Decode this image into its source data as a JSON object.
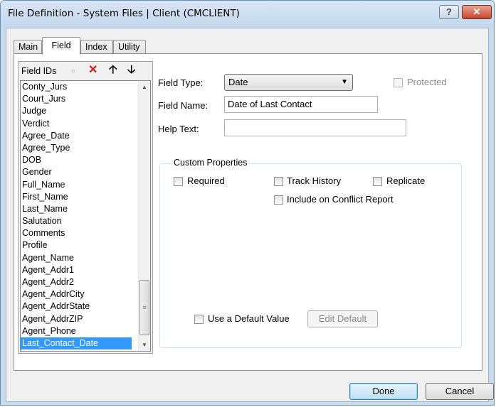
{
  "window": {
    "title": "File Definition - System Files | Client (CMCLIENT)",
    "help_label": "?",
    "close_label": "✕"
  },
  "tabs": [
    {
      "label": "Main",
      "active": false
    },
    {
      "label": "Field",
      "active": true
    },
    {
      "label": "Index",
      "active": false
    },
    {
      "label": "Utility",
      "active": false
    }
  ],
  "field_list": {
    "header": "Field IDs",
    "icons": [
      "new-icon",
      "delete-icon",
      "move-up-icon",
      "move-down-icon"
    ],
    "items": [
      "Conty_Jurs",
      "Court_Jurs",
      "Judge",
      "Verdict",
      "Agree_Date",
      "Agree_Type",
      "DOB",
      "Gender",
      "Full_Name",
      "First_Name",
      "Last_Name",
      "Salutation",
      "Comments",
      "Profile",
      "Agent_Name",
      "Agent_Addr1",
      "Agent_Addr2",
      "Agent_AddrCity",
      "Agent_AddrState",
      "Agent_AddrZIP",
      "Agent_Phone",
      "Last_Contact_Date"
    ],
    "selected": "Last_Contact_Date"
  },
  "form": {
    "field_type_label": "Field Type:",
    "field_type_value": "Date",
    "protected_label": "Protected",
    "field_name_label": "Field Name:",
    "field_name_value": "Date of Last Contact",
    "help_text_label": "Help Text:",
    "help_text_value": ""
  },
  "custom_properties": {
    "title": "Custom Properties",
    "required_label": "Required",
    "track_history_label": "Track History",
    "replicate_label": "Replicate",
    "include_conflict_label": "Include on Conflict Report",
    "default_value_label": "Use a Default Value",
    "edit_default_label": "Edit Default"
  },
  "footer": {
    "done_label": "Done",
    "cancel_label": "Cancel"
  },
  "colors": {
    "selection": "#3399ff",
    "delete_icon": "#d11a1a",
    "titlebar": "#c9daed"
  }
}
